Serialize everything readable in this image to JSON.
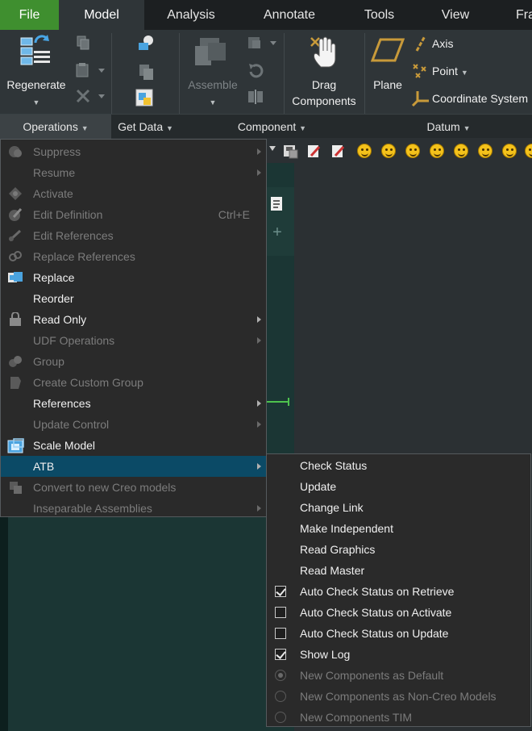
{
  "tabs": [
    {
      "label": "File"
    },
    {
      "label": "Model"
    },
    {
      "label": "Analysis"
    },
    {
      "label": "Annotate"
    },
    {
      "label": "Tools"
    },
    {
      "label": "View"
    },
    {
      "label": "Fra"
    }
  ],
  "ribbon": {
    "regenerate": "Regenerate",
    "assemble": "Assemble",
    "drag_line1": "Drag",
    "drag_line2": "Components",
    "plane": "Plane",
    "axis": "Axis",
    "point": "Point",
    "coordinate_system": "Coordinate System"
  },
  "groups": {
    "operations": "Operations",
    "get_data": "Get Data",
    "component": "Component",
    "datum": "Datum"
  },
  "operations_menu": [
    {
      "label": "Suppress",
      "enabled": false,
      "submenu": true,
      "icon": "suppress-icon"
    },
    {
      "label": "Resume",
      "enabled": false,
      "submenu": true,
      "icon": ""
    },
    {
      "label": "Activate",
      "enabled": false,
      "submenu": false,
      "icon": "activate-icon"
    },
    {
      "label": "Edit Definition",
      "enabled": false,
      "submenu": false,
      "shortcut": "Ctrl+E",
      "icon": "edit-definition-icon"
    },
    {
      "label": "Edit References",
      "enabled": false,
      "submenu": false,
      "icon": "edit-references-icon"
    },
    {
      "label": "Replace References",
      "enabled": false,
      "submenu": false,
      "icon": "replace-references-icon"
    },
    {
      "label": "Replace",
      "enabled": true,
      "submenu": false,
      "icon": "replace-icon"
    },
    {
      "label": "Reorder",
      "enabled": true,
      "submenu": false,
      "icon": ""
    },
    {
      "label": "Read Only",
      "enabled": true,
      "submenu": true,
      "icon": "lock-icon"
    },
    {
      "label": "UDF Operations",
      "enabled": false,
      "submenu": true,
      "icon": ""
    },
    {
      "label": "Group",
      "enabled": false,
      "submenu": false,
      "icon": "group-icon"
    },
    {
      "label": "Create Custom Group",
      "enabled": false,
      "submenu": false,
      "icon": "custom-group-icon"
    },
    {
      "label": "References",
      "enabled": true,
      "submenu": true,
      "icon": ""
    },
    {
      "label": "Update Control",
      "enabled": false,
      "submenu": true,
      "icon": ""
    },
    {
      "label": "Scale Model",
      "enabled": true,
      "submenu": false,
      "icon": "scale-model-icon"
    },
    {
      "label": "ATB",
      "enabled": true,
      "submenu": true,
      "highlighted": true,
      "icon": ""
    },
    {
      "label": "Convert to new Creo models",
      "enabled": false,
      "submenu": false,
      "icon": "convert-icon"
    },
    {
      "label": "Inseparable Assemblies",
      "enabled": false,
      "submenu": true,
      "icon": ""
    }
  ],
  "atb_menu": [
    {
      "label": "Check Status",
      "enabled": true,
      "control": "none"
    },
    {
      "label": "Update",
      "enabled": true,
      "control": "none"
    },
    {
      "label": "Change Link",
      "enabled": true,
      "control": "none"
    },
    {
      "label": "Make Independent",
      "enabled": true,
      "control": "none"
    },
    {
      "label": "Read Graphics",
      "enabled": true,
      "control": "none"
    },
    {
      "label": "Read Master",
      "enabled": true,
      "control": "none"
    },
    {
      "label": "Auto Check Status on Retrieve",
      "enabled": true,
      "control": "checkbox",
      "checked": true
    },
    {
      "label": "Auto Check Status on Activate",
      "enabled": true,
      "control": "checkbox",
      "checked": false
    },
    {
      "label": "Auto Check Status on Update",
      "enabled": true,
      "control": "checkbox",
      "checked": false
    },
    {
      "label": "Show Log",
      "enabled": true,
      "control": "checkbox",
      "checked": true
    },
    {
      "label": "New Components as Default",
      "enabled": false,
      "control": "radio",
      "checked": true
    },
    {
      "label": "New Components as Non-Creo Models",
      "enabled": false,
      "control": "radio",
      "checked": false
    },
    {
      "label": "New Components TIM",
      "enabled": false,
      "control": "radio",
      "checked": false
    }
  ],
  "colors": {
    "file_tab": "#3f8f2f",
    "highlight": "#0b4a66",
    "menu_bg": "#2a2a2a",
    "disabled_text": "#7c7c7c",
    "model_tree_bg": "#1b3634"
  }
}
